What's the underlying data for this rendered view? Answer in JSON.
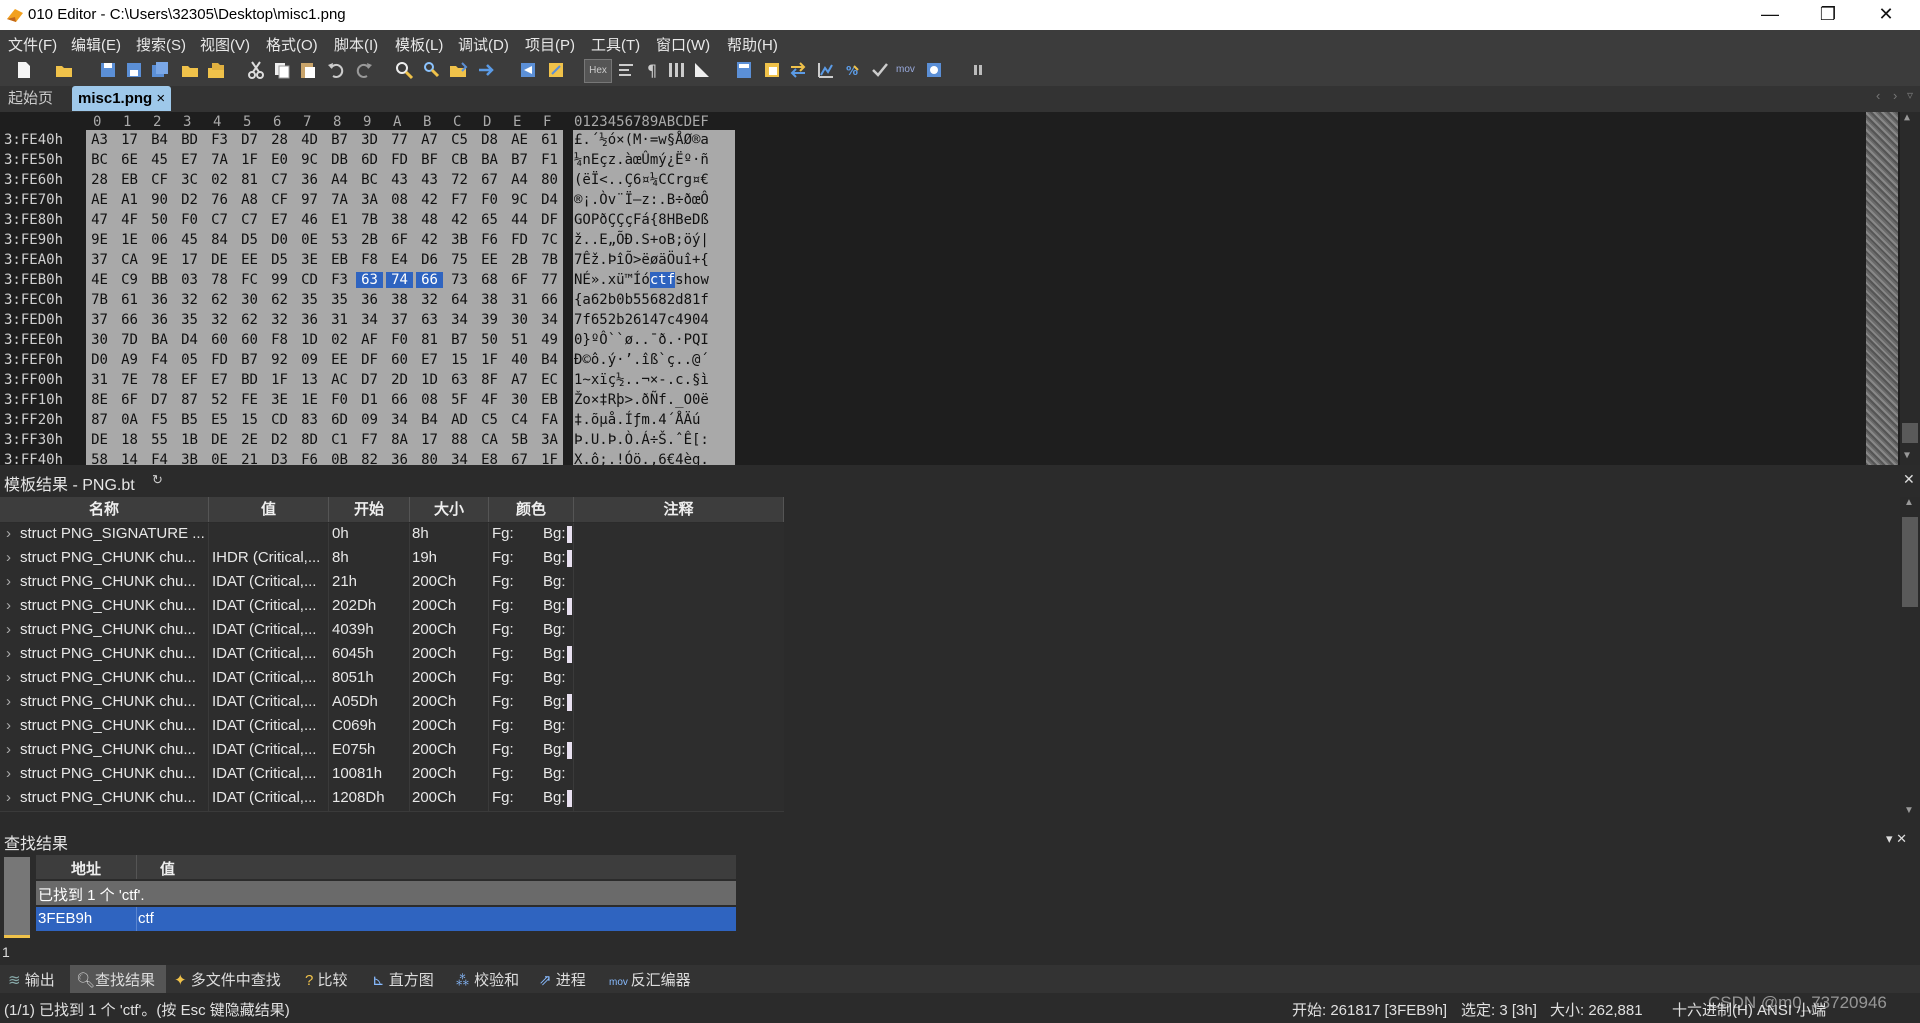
{
  "window": {
    "title": "010 Editor - C:\\Users\\32305\\Desktop\\misc1.png",
    "minimize": "—",
    "maximize": "❐",
    "close": "✕"
  },
  "menu": [
    "文件(F)",
    "编辑(E)",
    "搜索(S)",
    "视图(V)",
    "格式(O)",
    "脚本(I)",
    "模板(L)",
    "调试(D)",
    "项目(P)",
    "工具(T)",
    "窗口(W)",
    "帮助(H)"
  ],
  "toolbar": {
    "hex_label": "Hex",
    "mov_label": "mov"
  },
  "tabs": {
    "start": "起始页",
    "active": "misc1.png",
    "active_close": "×"
  },
  "hex": {
    "col_header": [
      "0",
      "1",
      "2",
      "3",
      "4",
      "5",
      "6",
      "7",
      "8",
      "9",
      "A",
      "B",
      "C",
      "D",
      "E",
      "F"
    ],
    "text_header": "0123456789ABCDEF",
    "rows": [
      {
        "addr": "3:FE40h",
        "bytes": [
          "A3",
          "17",
          "B4",
          "BD",
          "F3",
          "D7",
          "28",
          "4D",
          "B7",
          "3D",
          "77",
          "A7",
          "C5",
          "D8",
          "AE",
          "61"
        ],
        "text": "£.´½ó×(M·=w§ÅØ®a"
      },
      {
        "addr": "3:FE50h",
        "bytes": [
          "BC",
          "6E",
          "45",
          "E7",
          "7A",
          "1F",
          "E0",
          "9C",
          "DB",
          "6D",
          "FD",
          "BF",
          "CB",
          "BA",
          "B7",
          "F1"
        ],
        "text": "¼nEçz.àœÛmý¿Ëº·ñ"
      },
      {
        "addr": "3:FE60h",
        "bytes": [
          "28",
          "EB",
          "CF",
          "3C",
          "02",
          "81",
          "C7",
          "36",
          "A4",
          "BC",
          "43",
          "43",
          "72",
          "67",
          "A4",
          "80"
        ],
        "text": "(ëÏ<..Ç6¤¼CCrg¤€"
      },
      {
        "addr": "3:FE70h",
        "bytes": [
          "AE",
          "A1",
          "90",
          "D2",
          "76",
          "A8",
          "CF",
          "97",
          "7A",
          "3A",
          "08",
          "42",
          "F7",
          "F0",
          "9C",
          "D4"
        ],
        "text": "®¡.Òv¨Ï—z:.B÷ðœÔ"
      },
      {
        "addr": "3:FE80h",
        "bytes": [
          "47",
          "4F",
          "50",
          "F0",
          "C7",
          "C7",
          "E7",
          "46",
          "E1",
          "7B",
          "38",
          "48",
          "42",
          "65",
          "44",
          "DF"
        ],
        "text": "GOPðÇÇçFá{8HBeDß"
      },
      {
        "addr": "3:FE90h",
        "bytes": [
          "9E",
          "1E",
          "06",
          "45",
          "84",
          "D5",
          "D0",
          "0E",
          "53",
          "2B",
          "6F",
          "42",
          "3B",
          "F6",
          "FD",
          "7C"
        ],
        "text": "ž..E„ÕÐ.S+oB;öý|"
      },
      {
        "addr": "3:FEA0h",
        "bytes": [
          "37",
          "CA",
          "9E",
          "17",
          "DE",
          "EE",
          "D5",
          "3E",
          "EB",
          "F8",
          "E4",
          "D6",
          "75",
          "EE",
          "2B",
          "7B"
        ],
        "text": "7Êž.ÞîÕ>ëøäÖuî+{"
      },
      {
        "addr": "3:FEB0h",
        "bytes": [
          "4E",
          "C9",
          "BB",
          "03",
          "78",
          "FC",
          "99",
          "CD",
          "F3",
          "63",
          "74",
          "66",
          "73",
          "68",
          "6F",
          "77"
        ],
        "text": "NÉ».xü™Íóctfshow"
      },
      {
        "addr": "3:FEC0h",
        "bytes": [
          "7B",
          "61",
          "36",
          "32",
          "62",
          "30",
          "62",
          "35",
          "35",
          "36",
          "38",
          "32",
          "64",
          "38",
          "31",
          "66"
        ],
        "text": "{a62b0b55682d81f"
      },
      {
        "addr": "3:FED0h",
        "bytes": [
          "37",
          "66",
          "36",
          "35",
          "32",
          "62",
          "32",
          "36",
          "31",
          "34",
          "37",
          "63",
          "34",
          "39",
          "30",
          "34"
        ],
        "text": "7f652b26147c4904"
      },
      {
        "addr": "3:FEE0h",
        "bytes": [
          "30",
          "7D",
          "BA",
          "D4",
          "60",
          "60",
          "F8",
          "1D",
          "02",
          "AF",
          "F0",
          "81",
          "B7",
          "50",
          "51",
          "49"
        ],
        "text": "0}ºÔ``ø..¯ð.·PQI"
      },
      {
        "addr": "3:FEF0h",
        "bytes": [
          "D0",
          "A9",
          "F4",
          "05",
          "FD",
          "B7",
          "92",
          "09",
          "EE",
          "DF",
          "60",
          "E7",
          "15",
          "1F",
          "40",
          "B4"
        ],
        "text": "Ð©ô.ý·’.îß`ç..@´"
      },
      {
        "addr": "3:FF00h",
        "bytes": [
          "31",
          "7E",
          "78",
          "EF",
          "E7",
          "BD",
          "1F",
          "13",
          "AC",
          "D7",
          "2D",
          "1D",
          "63",
          "8F",
          "A7",
          "EC"
        ],
        "text": "1~xïç½..¬×-.c.§ì"
      },
      {
        "addr": "3:FF10h",
        "bytes": [
          "8E",
          "6F",
          "D7",
          "87",
          "52",
          "FE",
          "3E",
          "1E",
          "F0",
          "D1",
          "66",
          "08",
          "5F",
          "4F",
          "30",
          "EB"
        ],
        "text": "Žo×‡Rþ>.ðÑf._O0ë"
      },
      {
        "addr": "3:FF20h",
        "bytes": [
          "87",
          "0A",
          "F5",
          "B5",
          "E5",
          "15",
          "CD",
          "83",
          "6D",
          "09",
          "34",
          "B4",
          "AD",
          "C5",
          "C4",
          "FA"
        ],
        "text": "‡.õµå.Íƒm.4´­ÅÄú"
      },
      {
        "addr": "3:FF30h",
        "bytes": [
          "DE",
          "18",
          "55",
          "1B",
          "DE",
          "2E",
          "D2",
          "8D",
          "C1",
          "F7",
          "8A",
          "17",
          "88",
          "CA",
          "5B",
          "3A"
        ],
        "text": "Þ.U.Þ.Ò.Á÷Š.ˆÊ[:"
      },
      {
        "addr": "3:FF40h",
        "bytes": [
          "58",
          "14",
          "F4",
          "3B",
          "0E",
          "21",
          "D3",
          "F6",
          "0B",
          "82",
          "36",
          "80",
          "34",
          "E8",
          "67",
          "1F"
        ],
        "text": "X.ô;.!Óö.‚6€4èg."
      }
    ]
  },
  "template": {
    "title": "模板结果 - PNG.bt",
    "refresh_icon": "↻",
    "close": "✕",
    "columns": [
      "名称",
      "值",
      "开始",
      "大小",
      "颜色",
      "注释"
    ],
    "fg_label": "Fg:",
    "bg_label": "Bg:",
    "rows": [
      {
        "name": "struct PNG_SIGNATURE ...",
        "value": "",
        "start": "0h",
        "size": "8h",
        "bg": "#e8e0f0"
      },
      {
        "name": "struct PNG_CHUNK chu...",
        "value": "IHDR  (Critical,...",
        "start": "8h",
        "size": "19h",
        "bg": "#e8e0f0"
      },
      {
        "name": "struct PNG_CHUNK chu...",
        "value": "IDAT  (Critical,...",
        "start": "21h",
        "size": "200Ch",
        "bg": "#2d2d2d"
      },
      {
        "name": "struct PNG_CHUNK chu...",
        "value": "IDAT  (Critical,...",
        "start": "202Dh",
        "size": "200Ch",
        "bg": "#e8e0f0"
      },
      {
        "name": "struct PNG_CHUNK chu...",
        "value": "IDAT  (Critical,...",
        "start": "4039h",
        "size": "200Ch",
        "bg": "#2d2d2d"
      },
      {
        "name": "struct PNG_CHUNK chu...",
        "value": "IDAT  (Critical,...",
        "start": "6045h",
        "size": "200Ch",
        "bg": "#e8e0f0"
      },
      {
        "name": "struct PNG_CHUNK chu...",
        "value": "IDAT  (Critical,...",
        "start": "8051h",
        "size": "200Ch",
        "bg": "#2d2d2d"
      },
      {
        "name": "struct PNG_CHUNK chu...",
        "value": "IDAT  (Critical,...",
        "start": "A05Dh",
        "size": "200Ch",
        "bg": "#e8e0f0"
      },
      {
        "name": "struct PNG_CHUNK chu...",
        "value": "IDAT  (Critical,...",
        "start": "C069h",
        "size": "200Ch",
        "bg": "#2d2d2d"
      },
      {
        "name": "struct PNG_CHUNK chu...",
        "value": "IDAT  (Critical,...",
        "start": "E075h",
        "size": "200Ch",
        "bg": "#e8e0f0"
      },
      {
        "name": "struct PNG_CHUNK chu...",
        "value": "IDAT  (Critical,...",
        "start": "10081h",
        "size": "200Ch",
        "bg": "#2d2d2d"
      },
      {
        "name": "struct PNG_CHUNK chu...",
        "value": "IDAT  (Critical,...",
        "start": "1208Dh",
        "size": "200Ch",
        "bg": "#e8e0f0"
      }
    ]
  },
  "find": {
    "title": "查找结果",
    "controls": "▾ ✕",
    "col_addr": "地址",
    "col_val": "值",
    "summary": "已找到 1 个 'ctf'.",
    "result_addr": "3FEB9h",
    "result_val": "ctf",
    "left_count": "1"
  },
  "bottom_tabs": [
    "输出",
    "查找结果",
    "多文件中查找",
    "比较",
    "直方图",
    "校验和",
    "进程",
    "反汇编器"
  ],
  "status": {
    "left": "(1/1) 已找到 1 个 'ctf'。(按 Esc 键隐藏结果)",
    "start": "开始: 261817 [3FEB9h]",
    "selected": "选定: 3 [3h]",
    "size": "大小: 262,881",
    "encoding": "十六进制(H)   ANSI   小端",
    "watermark": "CSDN @m0_73720946"
  },
  "colors": {
    "accent": "#2f64c0",
    "tab_active": "#9ec8ea",
    "panel_bg": "#2b2b2b"
  }
}
